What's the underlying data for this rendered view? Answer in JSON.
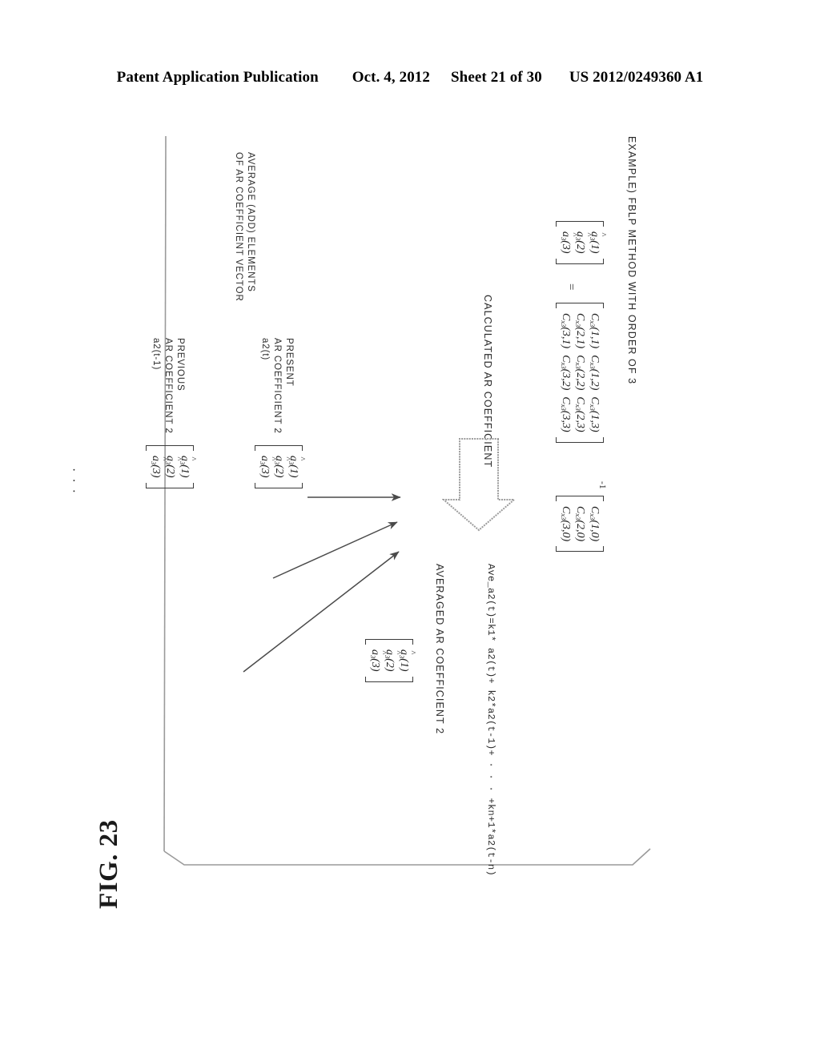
{
  "header": {
    "publication": "Patent Application Publication",
    "date": "Oct. 4, 2012",
    "sheet": "Sheet 21 of 30",
    "number": "US 2012/0249360 A1"
  },
  "figure": {
    "label": "FIG. 23",
    "caption": "EXAMPLE) FBLP METHOD WITH ORDER OF 3",
    "calculated_label": "CALCULATED AR COEFFICIENT",
    "averaged_label": "AVERAGED AR COEFFICIENT 2",
    "present_label_line1": "PRESENT",
    "present_label_line2": "AR COEFFICIENT 2",
    "present_label_line3": "a2(t)",
    "previous_label_line1": "PREVIOUS",
    "previous_label_line2": "AR COEFFICIENT 2",
    "previous_label_line3": "a2(t-1)",
    "average_note_line1": "AVERAGE (ADD) ELEMENTS",
    "average_note_line2": "OF AR COEFFICIENT VECTOR",
    "formula": "Ave_a2(t)=k1* a2(t)+ k2*a2(t-1)+ · · · +kn+1*a2(t-n)",
    "equals_sign": "=",
    "ellipsis_mid": "· · ·",
    "ellipsis_bottom": "· · ·"
  },
  "equation": {
    "lhs_vector": {
      "rows": [
        {
          "sym": "a",
          "sub": "3",
          "arg": "(1)"
        },
        {
          "sym": "a",
          "sub": "3",
          "arg": "(2)"
        },
        {
          "sym": "a",
          "sub": "3",
          "arg": "(3)"
        }
      ]
    },
    "matrix_left": {
      "rows": [
        [
          {
            "sym": "C",
            "sub": "x3",
            "arg": "(1,1)"
          },
          {
            "sym": "C",
            "sub": "x3",
            "arg": "(1,2)"
          },
          {
            "sym": "C",
            "sub": "x3",
            "arg": "(1,3)"
          }
        ],
        [
          {
            "sym": "C",
            "sub": "x3",
            "arg": "(2,1)"
          },
          {
            "sym": "C",
            "sub": "x3",
            "arg": "(2,2)"
          },
          {
            "sym": "C",
            "sub": "x3",
            "arg": "(2,3)"
          }
        ],
        [
          {
            "sym": "C",
            "sub": "x3",
            "arg": "(3,1)"
          },
          {
            "sym": "C",
            "sub": "x3",
            "arg": "(3,2)"
          },
          {
            "sym": "C",
            "sub": "x3",
            "arg": "(3,3)"
          }
        ]
      ]
    },
    "matrix_right": {
      "rows": [
        [
          {
            "sym": "C",
            "sub": "x3",
            "arg": "(1,0)"
          }
        ],
        [
          {
            "sym": "C",
            "sub": "x3",
            "arg": "(2,0)"
          }
        ],
        [
          {
            "sym": "C",
            "sub": "x3",
            "arg": "(3,0)"
          }
        ]
      ]
    },
    "inverse_exponent": "-1"
  },
  "vectors": {
    "averaged": {
      "rows": [
        {
          "sym": "a",
          "sub": "3",
          "arg": "(1)"
        },
        {
          "sym": "a",
          "sub": "3",
          "arg": "(2)"
        },
        {
          "sym": "a",
          "sub": "3",
          "arg": "(3)"
        }
      ]
    },
    "present": {
      "rows": [
        {
          "sym": "a",
          "sub": "3",
          "arg": "(1)"
        },
        {
          "sym": "a",
          "sub": "3",
          "arg": "(2)"
        },
        {
          "sym": "a",
          "sub": "3",
          "arg": "(3)"
        }
      ]
    },
    "previous": {
      "rows": [
        {
          "sym": "a",
          "sub": "3",
          "arg": "(1)"
        },
        {
          "sym": "a",
          "sub": "3",
          "arg": "(2)"
        },
        {
          "sym": "a",
          "sub": "3",
          "arg": "(3)"
        }
      ]
    }
  }
}
